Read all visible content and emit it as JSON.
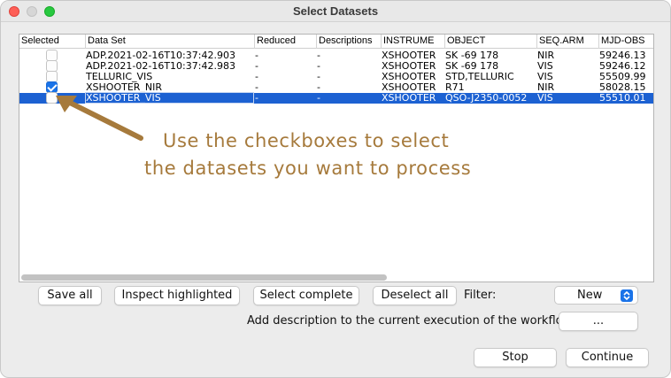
{
  "window": {
    "title": "Select Datasets"
  },
  "table": {
    "columns": [
      "Selected",
      "Data Set",
      "Reduced",
      "Descriptions",
      "INSTRUME",
      "OBJECT",
      "SEQ.ARM",
      "MJD-OBS"
    ],
    "rows": [
      {
        "checked": false,
        "dataset": "ADP.2021-02-16T10:37:42.903",
        "reduced": "-",
        "descriptions": "-",
        "instrume": "XSHOOTER",
        "object": "SK -69 178",
        "seqarm": "NIR",
        "mjdobs": "59246.13"
      },
      {
        "checked": false,
        "dataset": "ADP.2021-02-16T10:37:42.983",
        "reduced": "-",
        "descriptions": "-",
        "instrume": "XSHOOTER",
        "object": "SK -69 178",
        "seqarm": "VIS",
        "mjdobs": "59246.12"
      },
      {
        "checked": false,
        "dataset": "TELLURIC_VIS",
        "reduced": "-",
        "descriptions": "-",
        "instrume": "XSHOOTER",
        "object": "STD,TELLURIC",
        "seqarm": "VIS",
        "mjdobs": "55509.99"
      },
      {
        "checked": true,
        "dataset": "XSHOOTER_NIR",
        "reduced": "-",
        "descriptions": "-",
        "instrume": "XSHOOTER",
        "object": "R71",
        "seqarm": "NIR",
        "mjdobs": "58028.15"
      },
      {
        "checked": false,
        "dataset": "XSHOOTER_VIS",
        "reduced": "-",
        "descriptions": "-",
        "instrume": "XSHOOTER",
        "object": "QSO-J2350-0052",
        "seqarm": "VIS",
        "mjdobs": "55510.01",
        "selected": true
      }
    ]
  },
  "annotation": {
    "line1": "Use the checkboxes to select",
    "line2": "the datasets you want to process",
    "color": "#a67a3c"
  },
  "buttons": {
    "save_all": "Save all",
    "inspect_highlighted": "Inspect highlighted",
    "select_complete": "Select complete",
    "deselect_all": "Deselect all",
    "filter_label": "Filter:",
    "filter_value": "New",
    "description_label": "Add description to the current execution of the workflow:",
    "description_button": "...",
    "stop": "Stop",
    "continue": "Continue"
  },
  "colors": {
    "selection": "#1c61d2",
    "accent": "#1a73e8",
    "window_bg": "#ececec"
  },
  "icons": {
    "filter_select": "updown-chevron-icon",
    "arrow": "pointer-arrow-icon"
  }
}
